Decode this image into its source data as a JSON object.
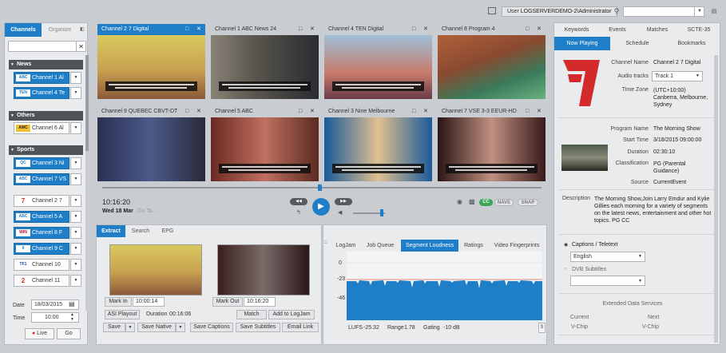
{
  "topbar": {
    "user_label": "User",
    "user_name": "LOGSERVERDEMO-2\\Administrator"
  },
  "sidebar": {
    "tabs": [
      "Channels",
      "Organize"
    ],
    "groups": [
      {
        "name": "News",
        "channels": [
          {
            "logo": "ABC",
            "label": "Channel 1  Al"
          },
          {
            "logo": "TEN",
            "label": "Channel 4  Te"
          }
        ]
      },
      {
        "name": "Others",
        "channels": [
          {
            "logo": "AMC",
            "label": "Channel 6  Al"
          }
        ]
      },
      {
        "name": "Sports",
        "channels": [
          {
            "logo": "QC",
            "label": "Channel 3  Ni"
          },
          {
            "logo": "ABC",
            "label": "Channel 7  VS"
          }
        ]
      }
    ],
    "extra_channels": [
      {
        "logo": "7",
        "label": "Channel 2  7"
      },
      {
        "logo": "ABC",
        "label": "Channel 5  A"
      },
      {
        "logo": "WIN",
        "label": "Channel 8  F"
      },
      {
        "logo": "9",
        "label": "Channel 9  C"
      },
      {
        "logo": "TF1",
        "label": "Channel 10"
      },
      {
        "logo": "2",
        "label": "Channel 11"
      }
    ],
    "date_label": "Date",
    "date_value": "18/03/2015",
    "time_label": "Time",
    "time_value": "10:00",
    "live_label": "Live",
    "go_label": "Go"
  },
  "tiles": [
    {
      "title": "Channel 2  7 Digital",
      "bg": "#d8b85a"
    },
    {
      "title": "Channel 1  ABC News 24",
      "bg": "#6e6a63"
    },
    {
      "title": "Channel 4  TEN Digital",
      "bg": "#8fb0c8"
    },
    {
      "title": "Channel 8  Program 4",
      "bg": "#a0563a"
    },
    {
      "title": "Channel 9  QUEBEC CBVT-DT",
      "bg": "#3a3f5a"
    },
    {
      "title": "Channel 5  ABC",
      "bg": "#8a3a2c"
    },
    {
      "title": "Channel 3  Nine Melbourne",
      "bg": "#2a6aa8"
    },
    {
      "title": "Channel 7  VSE 3-3 EEUR-HD",
      "bg": "#3b2020"
    }
  ],
  "timeline": {
    "time": "10:16:20",
    "date": "Wed 18 Mar",
    "goto": "Go To..."
  },
  "controls": {
    "cc": "CC",
    "nave": "NAVE",
    "snap": "SNAP"
  },
  "extract": {
    "tabs": [
      "Extract",
      "Search",
      "EPG"
    ],
    "mark_in_label": "Mark In",
    "mark_in_value": "10:00:14",
    "mark_out_label": "Mark Out",
    "mark_out_value": "10:16:20",
    "asi_label": "ASI Playout",
    "duration_label": "Duration",
    "duration_value": "00:16:06",
    "match_label": "Match",
    "addlog_label": "Add to LogJam",
    "save_label": "Save",
    "save_native_label": "Save Native",
    "save_captions_label": "Save Captions",
    "save_subtitles_label": "Save Subtitles",
    "email_link_label": "Email Link"
  },
  "loudness": {
    "tabs": [
      "LogJam",
      "Job Queue",
      "Segment Loudness",
      "Ratings",
      "Video Fingerprints"
    ],
    "y_labels": [
      "0",
      "-23",
      "-46"
    ],
    "lufs_label": "LUFS",
    "lufs_value": "-25.32",
    "range_label": "Range",
    "range_value": "1.78",
    "gating_label": "Gating",
    "gating_value": "-10 dB"
  },
  "right": {
    "tabs": [
      "Keywords",
      "Events",
      "Matches",
      "SCTE-35"
    ],
    "subtabs": [
      "Now Playing",
      "Schedule",
      "Bookmarks"
    ],
    "channel_name_label": "Channel Name",
    "channel_name_value": "Channel 2  7 Digital",
    "audio_label": "Audio tracks",
    "audio_value": "Track 1",
    "tz_label": "Time Zone",
    "tz_value": "(UTC+10:00) Canberra, Melbourne, Sydney",
    "program_label": "Program Name",
    "program_value": "The Morning Show",
    "start_label": "Start Time",
    "start_value": "3/18/2015 09:00:00",
    "dur_label": "Duration",
    "dur_value": "02:30:10",
    "class_label": "Classification",
    "class_value": "PG (Parental Guidance)",
    "source_label": "Source",
    "source_value": "CurrentEvent",
    "desc_label": "Description",
    "desc_value": "The Morning Show,Join Larry Emdur and Kylie Gillies each morning for a variety of segments on the latest news, entertainment and other hot topics. PG CC",
    "captions_label": "Captions / Teletext",
    "captions_value": "English",
    "dvb_label": "DVB Subtitles",
    "eds_label": "Extended Data Services",
    "current_label": "Current",
    "next_label": "Next",
    "vchip_current": "V-Chip",
    "vchip_next": "V-Chip"
  }
}
